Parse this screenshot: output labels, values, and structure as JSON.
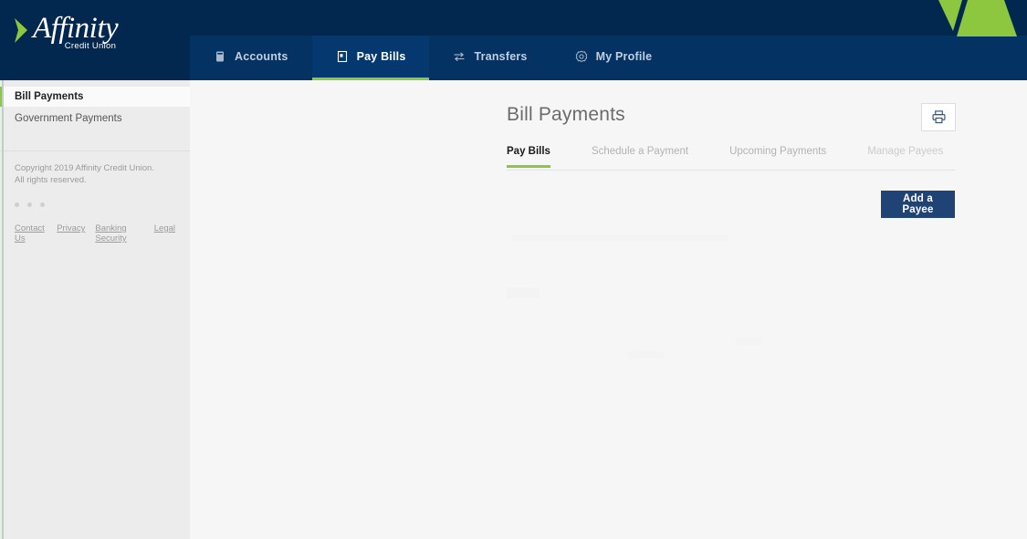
{
  "brand": {
    "name": "Affinity",
    "tagline": "Credit Union",
    "chevron_color": "#8dc63f",
    "header_dark": "#022850",
    "header_nav": "#043263",
    "accent_green": "#8dc63f"
  },
  "topnav": {
    "items": [
      {
        "label": "Accounts",
        "icon": "card-icon",
        "active": false
      },
      {
        "label": "Pay Bills",
        "icon": "bill-icon",
        "active": true
      },
      {
        "label": "Transfers",
        "icon": "transfer-icon",
        "active": false
      },
      {
        "label": "My Profile",
        "icon": "gear-icon",
        "active": false
      }
    ]
  },
  "sidebar": {
    "items": [
      {
        "label": "Bill Payments",
        "active": true
      },
      {
        "label": "Government Payments",
        "active": false
      }
    ],
    "footer": {
      "copyright_line1": "Copyright 2019 Affinity Credit Union.",
      "copyright_line2": "All rights reserved.",
      "social_icons": [
        "facebook-icon",
        "twitter-icon",
        "youtube-icon"
      ],
      "links": [
        {
          "label": "Contact Us"
        },
        {
          "label": "Privacy"
        },
        {
          "label": "Banking Security"
        },
        {
          "label": "Legal"
        }
      ]
    }
  },
  "main": {
    "title": "Bill Payments",
    "print_button": {
      "icon": "printer-icon",
      "label": "Print"
    },
    "tabs": [
      {
        "label": "Pay Bills",
        "active": true,
        "dim": false
      },
      {
        "label": "Schedule a Payment",
        "active": false,
        "dim": false
      },
      {
        "label": "Upcoming Payments",
        "active": false,
        "dim": false
      },
      {
        "label": "Manage Payees",
        "active": false,
        "dim": true
      }
    ],
    "add_payee_label": "Add a Payee"
  }
}
